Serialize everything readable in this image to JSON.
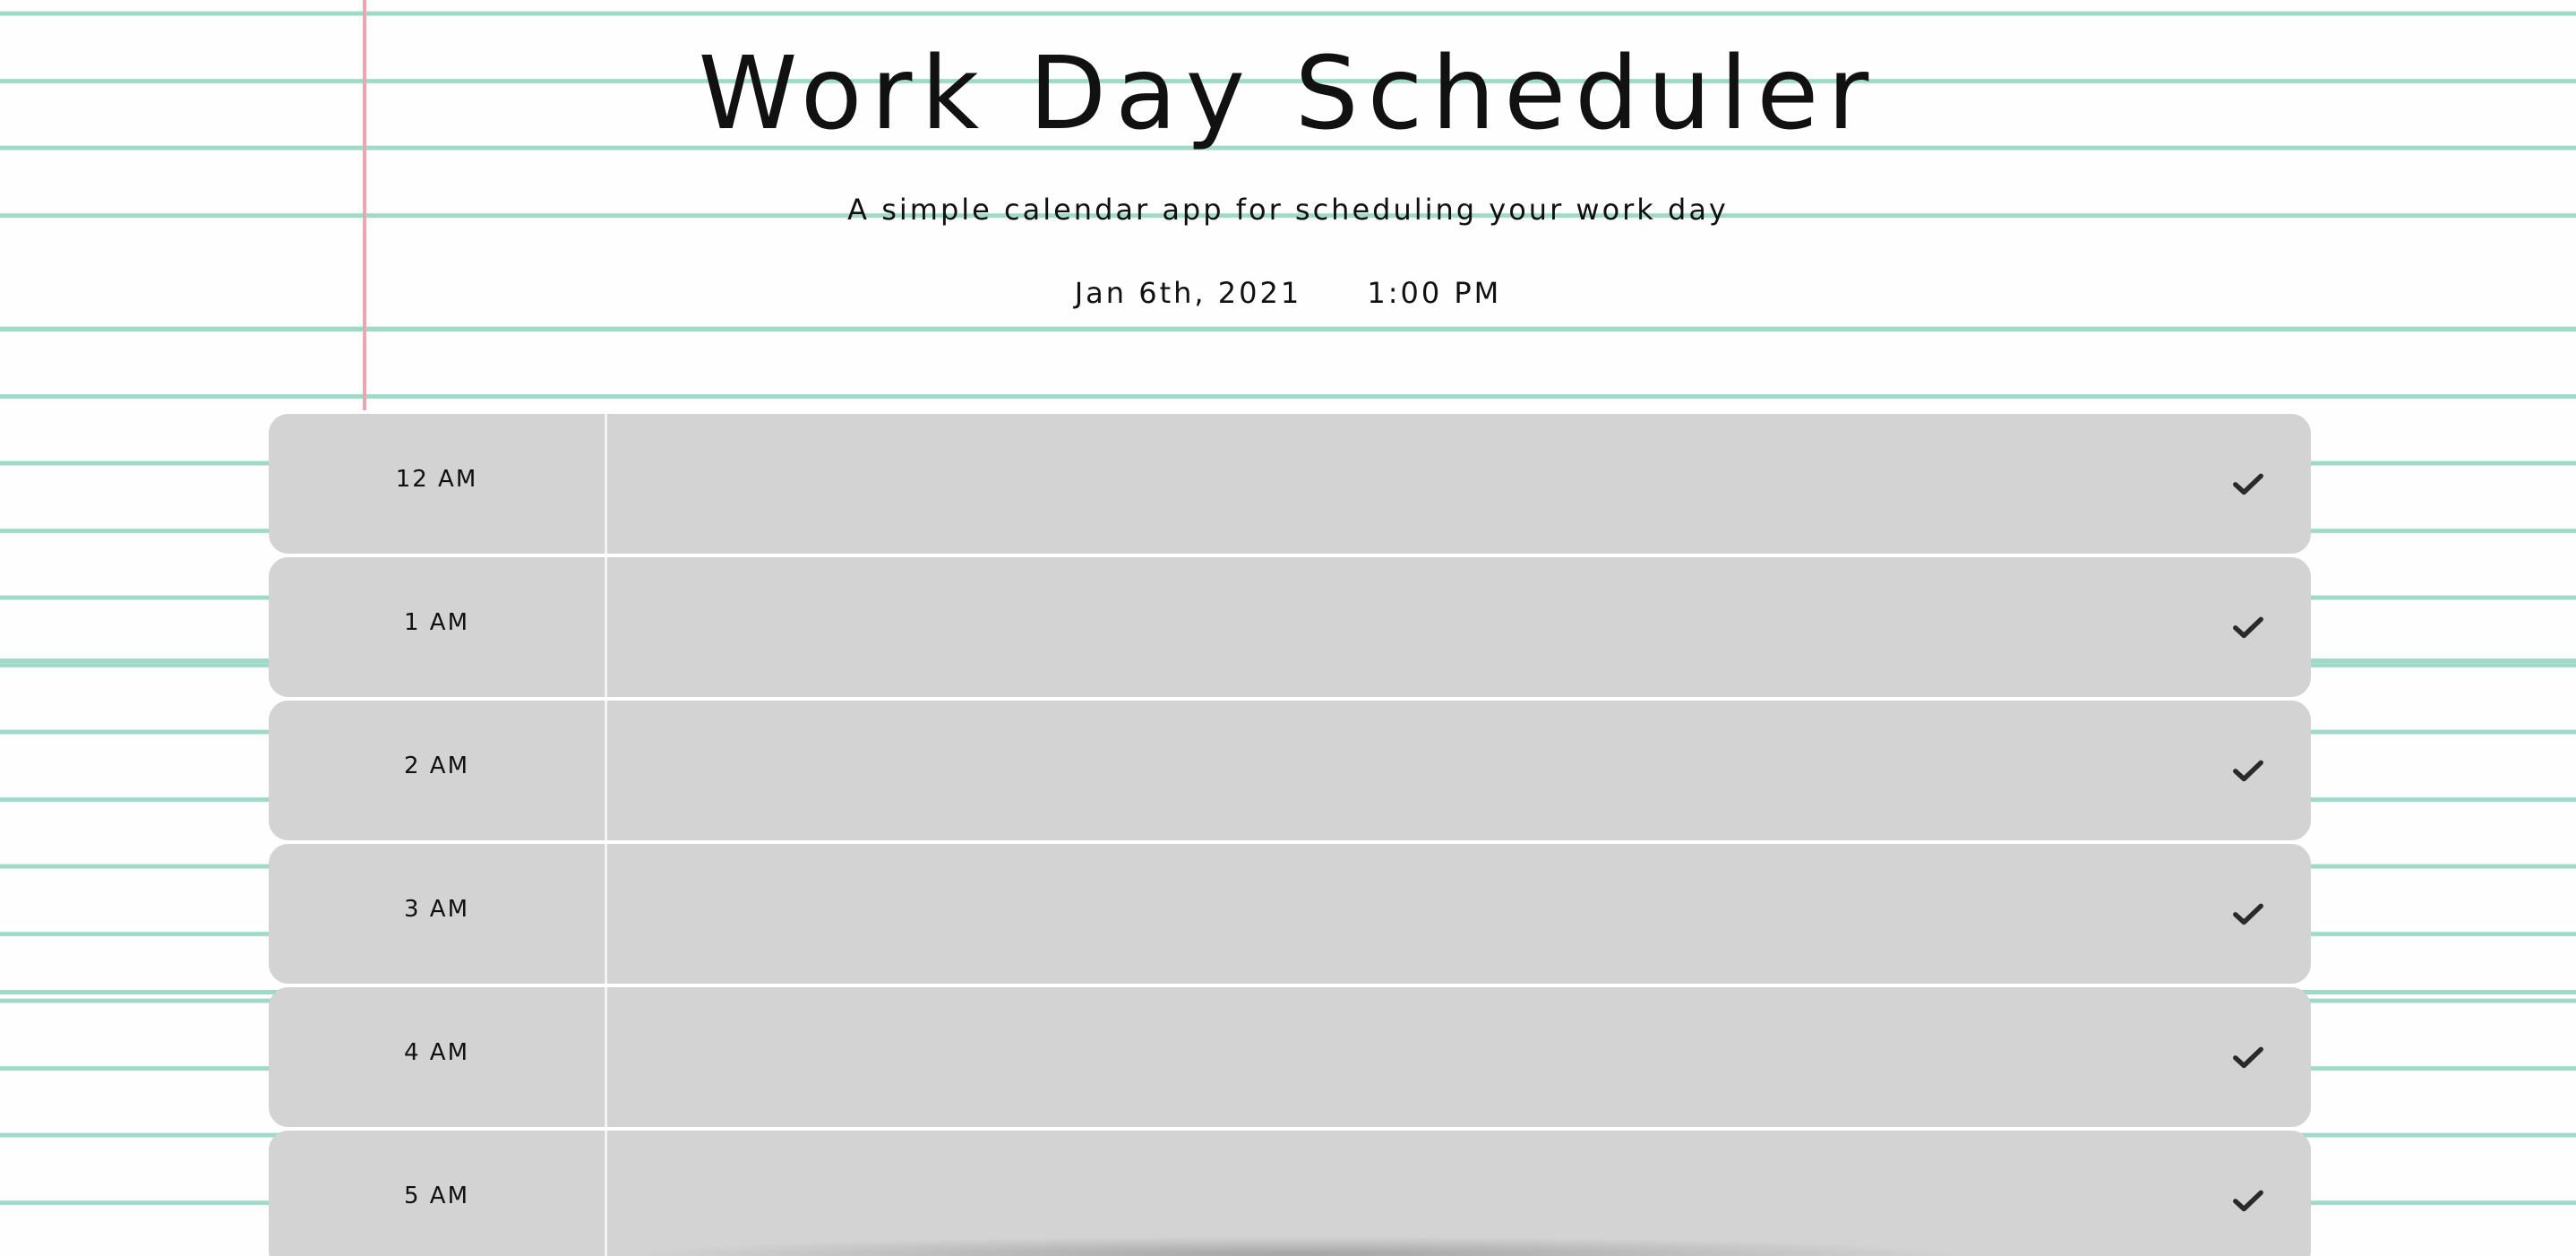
{
  "header": {
    "title": "Work Day Scheduler",
    "subtitle": "A simple calendar app for scheduling your work day",
    "date": "Jan 6th, 2021",
    "time": "1:00 PM"
  },
  "colors": {
    "row_background": "#d3d3d3",
    "ruled_line": "#9fd9c7",
    "margin_line": "#e8a8ad"
  },
  "schedule": {
    "rows": [
      {
        "hour": "12 AM",
        "text": "",
        "save_icon": "check-icon"
      },
      {
        "hour": "1 AM",
        "text": "",
        "save_icon": "check-icon"
      },
      {
        "hour": "2 AM",
        "text": "",
        "save_icon": "check-icon"
      },
      {
        "hour": "3 AM",
        "text": "",
        "save_icon": "check-icon"
      },
      {
        "hour": "4 AM",
        "text": "",
        "save_icon": "check-icon"
      },
      {
        "hour": "5 AM",
        "text": "",
        "save_icon": "check-icon"
      }
    ]
  }
}
